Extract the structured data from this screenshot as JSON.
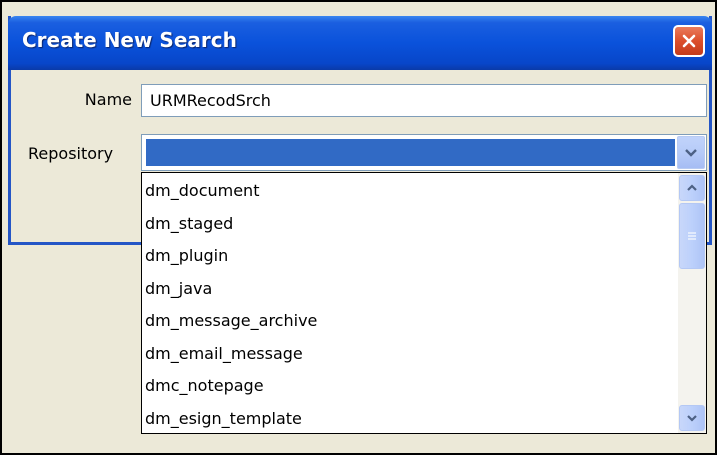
{
  "dialog": {
    "title": "Create New Search",
    "close_icon": "close-x-icon"
  },
  "form": {
    "name_label": "Name",
    "name_value": "URMRecodSrch",
    "repository_label": "Repository",
    "repository_value": ""
  },
  "dropdown": {
    "items": [
      "dm_document",
      "dm_staged",
      "dm_plugin",
      "dm_java",
      "dm_message_archive",
      "dm_email_message",
      "dmc_notepage",
      "dm_esign_template"
    ]
  },
  "colors": {
    "titlebar": "#0a52db",
    "selection": "#316ac5",
    "close_button": "#dc4f2c",
    "dialog_background": "#ece9d8"
  }
}
